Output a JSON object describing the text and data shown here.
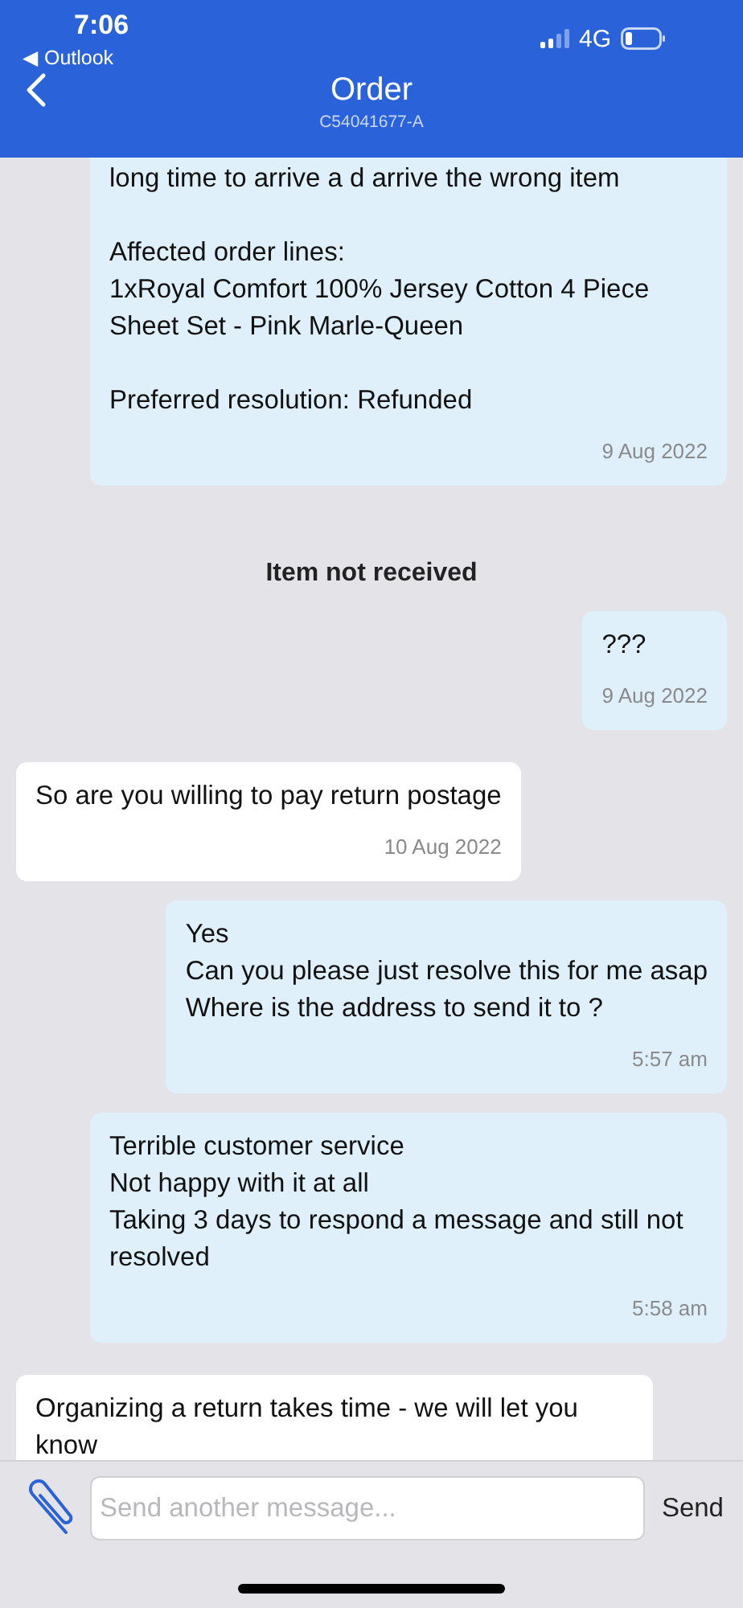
{
  "status_bar": {
    "time": "7:06",
    "back_app": "◀ Outlook",
    "network": "4G"
  },
  "header": {
    "title": "Order",
    "subtitle": "C54041677-A"
  },
  "messages": [
    {
      "kind": "sent",
      "paragraphs": [
        [
          "long time to arrive a d arrive the wrong item"
        ],
        [
          "Affected order lines:",
          "1xRoyal Comfort 100% Jersey Cotton 4 Piece Sheet Set - Pink Marle-Queen"
        ],
        [
          "Preferred resolution: Refunded"
        ]
      ],
      "time": "9 Aug 2022"
    },
    {
      "kind": "divider",
      "text": "Item not received"
    },
    {
      "kind": "sent",
      "paragraphs": [
        [
          "???"
        ]
      ],
      "time": "9 Aug 2022"
    },
    {
      "kind": "received",
      "paragraphs": [
        [
          "So are you willing to pay return postage"
        ]
      ],
      "time": "10 Aug 2022"
    },
    {
      "kind": "sent",
      "paragraphs": [
        [
          "Yes",
          "Can you please just resolve this for me asap",
          "Where is the address to send it to ?"
        ]
      ],
      "time": "5:57 am"
    },
    {
      "kind": "sent",
      "paragraphs": [
        [
          "Terrible customer service",
          "Not happy with it at all",
          "Taking 3 days to respond a message and still not resolved"
        ]
      ],
      "time": "5:58 am"
    },
    {
      "kind": "received",
      "paragraphs": [
        [
          "Organizing a return takes time - we will let you know"
        ]
      ]
    }
  ],
  "composer": {
    "placeholder": "Send another message...",
    "send_label": "Send"
  }
}
